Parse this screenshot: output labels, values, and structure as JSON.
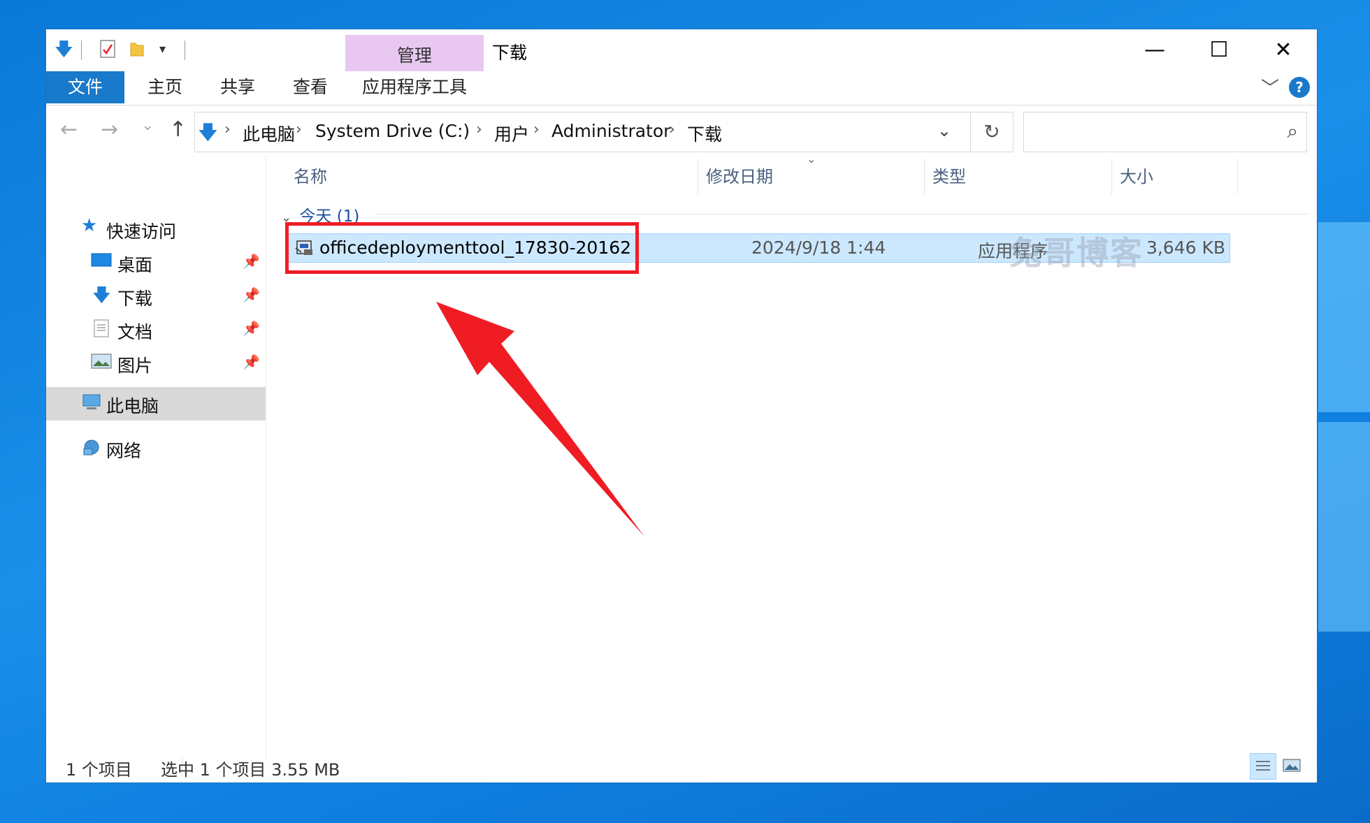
{
  "window": {
    "title": "下载",
    "context_tab_group": "管理",
    "controls": {
      "minimize": "—",
      "maximize": "☐",
      "close": "✕"
    }
  },
  "ribbon": {
    "tabs": [
      "文件",
      "主页",
      "共享",
      "查看",
      "应用程序工具"
    ],
    "help": "?"
  },
  "nav": {
    "back": "←",
    "forward": "→",
    "recent": "⌄",
    "up": "↑",
    "breadcrumb": [
      "此电脑",
      "System Drive (C:)",
      "用户",
      "Administrator",
      "下载"
    ],
    "refresh": "↻",
    "search_placeholder": ""
  },
  "sidebar": {
    "quick_access": "快速访问",
    "items": [
      {
        "label": "桌面",
        "icon": "desktop-icon"
      },
      {
        "label": "下载",
        "icon": "download-icon"
      },
      {
        "label": "文档",
        "icon": "document-icon"
      },
      {
        "label": "图片",
        "icon": "pictures-icon"
      }
    ],
    "this_pc": "此电脑",
    "network": "网络"
  },
  "columns": [
    "名称",
    "修改日期",
    "类型",
    "大小"
  ],
  "group": {
    "label": "今天 (1)"
  },
  "files": [
    {
      "name": "officedeploymenttool_17830-20162",
      "modified": "2024/9/18 1:44",
      "type": "应用程序",
      "size": "3,646 KB"
    }
  ],
  "watermark": "兔哥博客",
  "status": {
    "count": "1 个项目",
    "selection": "选中 1 个项目  3.55 MB"
  },
  "colors": {
    "accent": "#1979ca",
    "selection": "#cce8ff",
    "annotation": "#f01c24",
    "context_tab": "#e8c8f0"
  }
}
